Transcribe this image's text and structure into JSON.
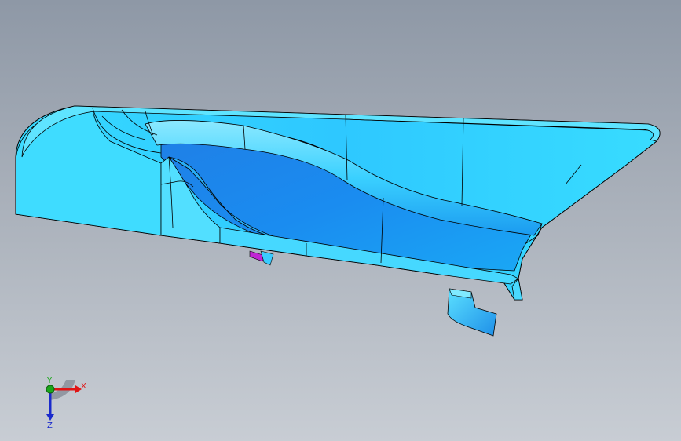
{
  "viewport": {
    "background_top": "#8e98a6",
    "background_bottom": "#c8cdd4"
  },
  "model": {
    "face_color": "#33d6ff",
    "face_shadow_color": "#1a8fe8",
    "edge_color": "#000000",
    "highlight_color": "#c026d3"
  },
  "triad": {
    "x_label": "X",
    "y_label": "Y",
    "z_label": "Z",
    "x_color": "#e01414",
    "y_color": "#1aa61a",
    "z_color": "#1a2acc"
  }
}
